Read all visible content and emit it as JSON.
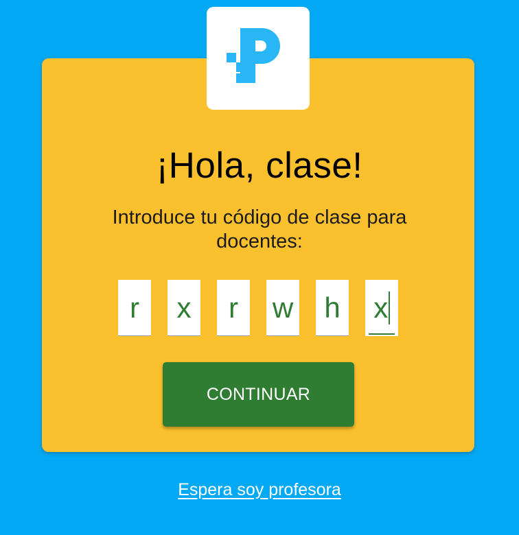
{
  "logo": {
    "icon": "brand-p-logo-icon",
    "color": "#29B6F6"
  },
  "greeting": {
    "title": "¡Hola, clase!"
  },
  "instructions": {
    "text": "Introduce tu código de clase para docentes:"
  },
  "class_code": {
    "characters": [
      "r",
      "x",
      "r",
      "w",
      "h",
      "x"
    ]
  },
  "actions": {
    "continue_label": "CONTINUAR",
    "teacher_link": "Espera soy profesora"
  },
  "colors": {
    "background": "#03A9F4",
    "card": "#FBC02D",
    "button": "#2E7D32",
    "code_text": "#2E7D32"
  }
}
